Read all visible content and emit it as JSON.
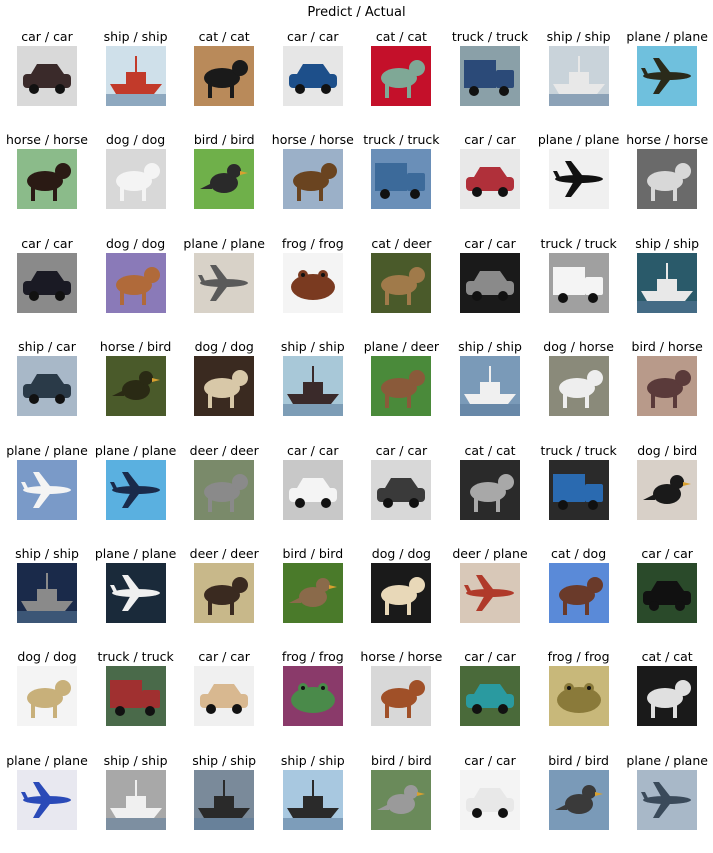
{
  "title": "Predict / Actual",
  "grid": [
    [
      {
        "label": "car / car",
        "bg": "#d9d9d9",
        "fg": "#3a2a2a",
        "shape": "car"
      },
      {
        "label": "ship / ship",
        "bg": "#cfe0ea",
        "fg": "#c23a2a",
        "shape": "ship"
      },
      {
        "label": "cat / cat",
        "bg": "#b98a5a",
        "fg": "#1a1a1a",
        "shape": "animal"
      },
      {
        "label": "car / car",
        "bg": "#e6e6e6",
        "fg": "#1d4f8a",
        "shape": "car"
      },
      {
        "label": "cat / cat",
        "bg": "#c4102a",
        "fg": "#7fa896",
        "shape": "animal"
      },
      {
        "label": "truck / truck",
        "bg": "#8aa0a8",
        "fg": "#2b4a78",
        "shape": "truck"
      },
      {
        "label": "ship / ship",
        "bg": "#c9d3da",
        "fg": "#e8e8e8",
        "shape": "ship"
      },
      {
        "label": "plane / plane",
        "bg": "#6fc0dd",
        "fg": "#2a2a1a",
        "shape": "plane"
      }
    ],
    [
      {
        "label": "horse / horse",
        "bg": "#8bbb8a",
        "fg": "#2a1a14",
        "shape": "animal"
      },
      {
        "label": "dog / dog",
        "bg": "#d8d8d8",
        "fg": "#f4f4f4",
        "shape": "animal"
      },
      {
        "label": "bird / bird",
        "bg": "#6fb04a",
        "fg": "#2a2a2a",
        "shape": "bird"
      },
      {
        "label": "horse / horse",
        "bg": "#9bb0c8",
        "fg": "#6a4420",
        "shape": "animal"
      },
      {
        "label": "truck / truck",
        "bg": "#6a8fb8",
        "fg": "#3c6a9a",
        "shape": "truck"
      },
      {
        "label": "car / car",
        "bg": "#e8e8e8",
        "fg": "#b0303a",
        "shape": "car"
      },
      {
        "label": "plane / plane",
        "bg": "#f0f0f0",
        "fg": "#111111",
        "shape": "plane"
      },
      {
        "label": "horse / horse",
        "bg": "#6a6a6a",
        "fg": "#d8d8d8",
        "shape": "animal"
      }
    ],
    [
      {
        "label": "car / car",
        "bg": "#8a8a8a",
        "fg": "#1a1a24",
        "shape": "car"
      },
      {
        "label": "dog / dog",
        "bg": "#8a7ab8",
        "fg": "#b06a3a",
        "shape": "animal"
      },
      {
        "label": "plane / plane",
        "bg": "#d8d2c8",
        "fg": "#5a5a5a",
        "shape": "plane"
      },
      {
        "label": "frog / frog",
        "bg": "#f4f4f4",
        "fg": "#7a3a20",
        "shape": "frog"
      },
      {
        "label": "cat / deer",
        "bg": "#4a5a2a",
        "fg": "#a07a4a",
        "shape": "animal"
      },
      {
        "label": "car / car",
        "bg": "#1a1a1a",
        "fg": "#8a8a8a",
        "shape": "car"
      },
      {
        "label": "truck / truck",
        "bg": "#a0a0a0",
        "fg": "#f4f4f4",
        "shape": "truck"
      },
      {
        "label": "ship / ship",
        "bg": "#2a5a6a",
        "fg": "#e8e8e8",
        "shape": "ship"
      }
    ],
    [
      {
        "label": "ship / car",
        "bg": "#a8b8c8",
        "fg": "#2a3a48",
        "shape": "car"
      },
      {
        "label": "horse / bird",
        "bg": "#4a5a2a",
        "fg": "#2a2a14",
        "shape": "bird"
      },
      {
        "label": "dog / dog",
        "bg": "#3a2a20",
        "fg": "#d8c8a8",
        "shape": "animal"
      },
      {
        "label": "ship / ship",
        "bg": "#a8c8d8",
        "fg": "#3a2a2a",
        "shape": "ship"
      },
      {
        "label": "plane / deer",
        "bg": "#4a8a3a",
        "fg": "#8a5a3a",
        "shape": "animal"
      },
      {
        "label": "ship / ship",
        "bg": "#7a9ab8",
        "fg": "#f0f0f0",
        "shape": "ship"
      },
      {
        "label": "dog / horse",
        "bg": "#8a8a7a",
        "fg": "#eeeeee",
        "shape": "animal"
      },
      {
        "label": "bird / horse",
        "bg": "#b89a8a",
        "fg": "#5a3a3a",
        "shape": "animal"
      }
    ],
    [
      {
        "label": "plane / plane",
        "bg": "#7a9ac8",
        "fg": "#f4f4f4",
        "shape": "plane"
      },
      {
        "label": "plane / plane",
        "bg": "#5ab0e0",
        "fg": "#1a2a4a",
        "shape": "plane"
      },
      {
        "label": "deer / deer",
        "bg": "#7a8a6a",
        "fg": "#8a8a8a",
        "shape": "animal"
      },
      {
        "label": "car / car",
        "bg": "#c8c8c8",
        "fg": "#f4f4f4",
        "shape": "car"
      },
      {
        "label": "car / car",
        "bg": "#d8d8d8",
        "fg": "#3a3a3a",
        "shape": "car"
      },
      {
        "label": "cat / cat",
        "bg": "#2a2a2a",
        "fg": "#a8a8a8",
        "shape": "animal"
      },
      {
        "label": "truck / truck",
        "bg": "#2a2a2a",
        "fg": "#2a6ab0",
        "shape": "truck"
      },
      {
        "label": "dog / bird",
        "bg": "#d8d0c8",
        "fg": "#1a1a1a",
        "shape": "bird"
      }
    ],
    [
      {
        "label": "ship / ship",
        "bg": "#1a2a4a",
        "fg": "#8a8a8a",
        "shape": "ship"
      },
      {
        "label": "plane / plane",
        "bg": "#1a2a3a",
        "fg": "#f0f0f0",
        "shape": "plane"
      },
      {
        "label": "deer / deer",
        "bg": "#c8b88a",
        "fg": "#3a2a20",
        "shape": "animal"
      },
      {
        "label": "bird / bird",
        "bg": "#4a7a2a",
        "fg": "#8a6a4a",
        "shape": "bird"
      },
      {
        "label": "dog / dog",
        "bg": "#1a1a1a",
        "fg": "#e8d8b8",
        "shape": "animal"
      },
      {
        "label": "deer / plane",
        "bg": "#d8c8b8",
        "fg": "#b03a2a",
        "shape": "plane"
      },
      {
        "label": "cat / dog",
        "bg": "#5a8ad8",
        "fg": "#6a3a2a",
        "shape": "animal"
      },
      {
        "label": "car / car",
        "bg": "#2a4a2a",
        "fg": "#111111",
        "shape": "car"
      }
    ],
    [
      {
        "label": "dog / dog",
        "bg": "#f4f4f4",
        "fg": "#c8b07a",
        "shape": "animal"
      },
      {
        "label": "truck / truck",
        "bg": "#4a6a4a",
        "fg": "#a03030",
        "shape": "truck"
      },
      {
        "label": "car / car",
        "bg": "#f0f0f0",
        "fg": "#d8b890",
        "shape": "car"
      },
      {
        "label": "frog / frog",
        "bg": "#8a3a6a",
        "fg": "#4a8a4a",
        "shape": "frog"
      },
      {
        "label": "horse / horse",
        "bg": "#d8d8d8",
        "fg": "#a05028",
        "shape": "animal"
      },
      {
        "label": "car / car",
        "bg": "#4a6a3a",
        "fg": "#2a9aa0",
        "shape": "car"
      },
      {
        "label": "frog / frog",
        "bg": "#c8b87a",
        "fg": "#8a7a3a",
        "shape": "frog"
      },
      {
        "label": "cat / cat",
        "bg": "#1a1a1a",
        "fg": "#e0e0e0",
        "shape": "animal"
      }
    ],
    [
      {
        "label": "plane / plane",
        "bg": "#e8e8f0",
        "fg": "#2a4ab8",
        "shape": "plane"
      },
      {
        "label": "ship / ship",
        "bg": "#a8a8a8",
        "fg": "#f0f0f0",
        "shape": "ship"
      },
      {
        "label": "ship / ship",
        "bg": "#7a8a9a",
        "fg": "#2a2a2a",
        "shape": "ship"
      },
      {
        "label": "ship / ship",
        "bg": "#a8c8e0",
        "fg": "#2a2a2a",
        "shape": "ship"
      },
      {
        "label": "bird / bird",
        "bg": "#6a8a5a",
        "fg": "#9a9a9a",
        "shape": "bird"
      },
      {
        "label": "car / car",
        "bg": "#f4f4f4",
        "fg": "#e8e8e8",
        "shape": "car"
      },
      {
        "label": "bird / bird",
        "bg": "#7a9ab8",
        "fg": "#3a3a3a",
        "shape": "bird"
      },
      {
        "label": "plane / plane",
        "bg": "#a8b8c8",
        "fg": "#3a4a5a",
        "shape": "plane"
      }
    ]
  ]
}
